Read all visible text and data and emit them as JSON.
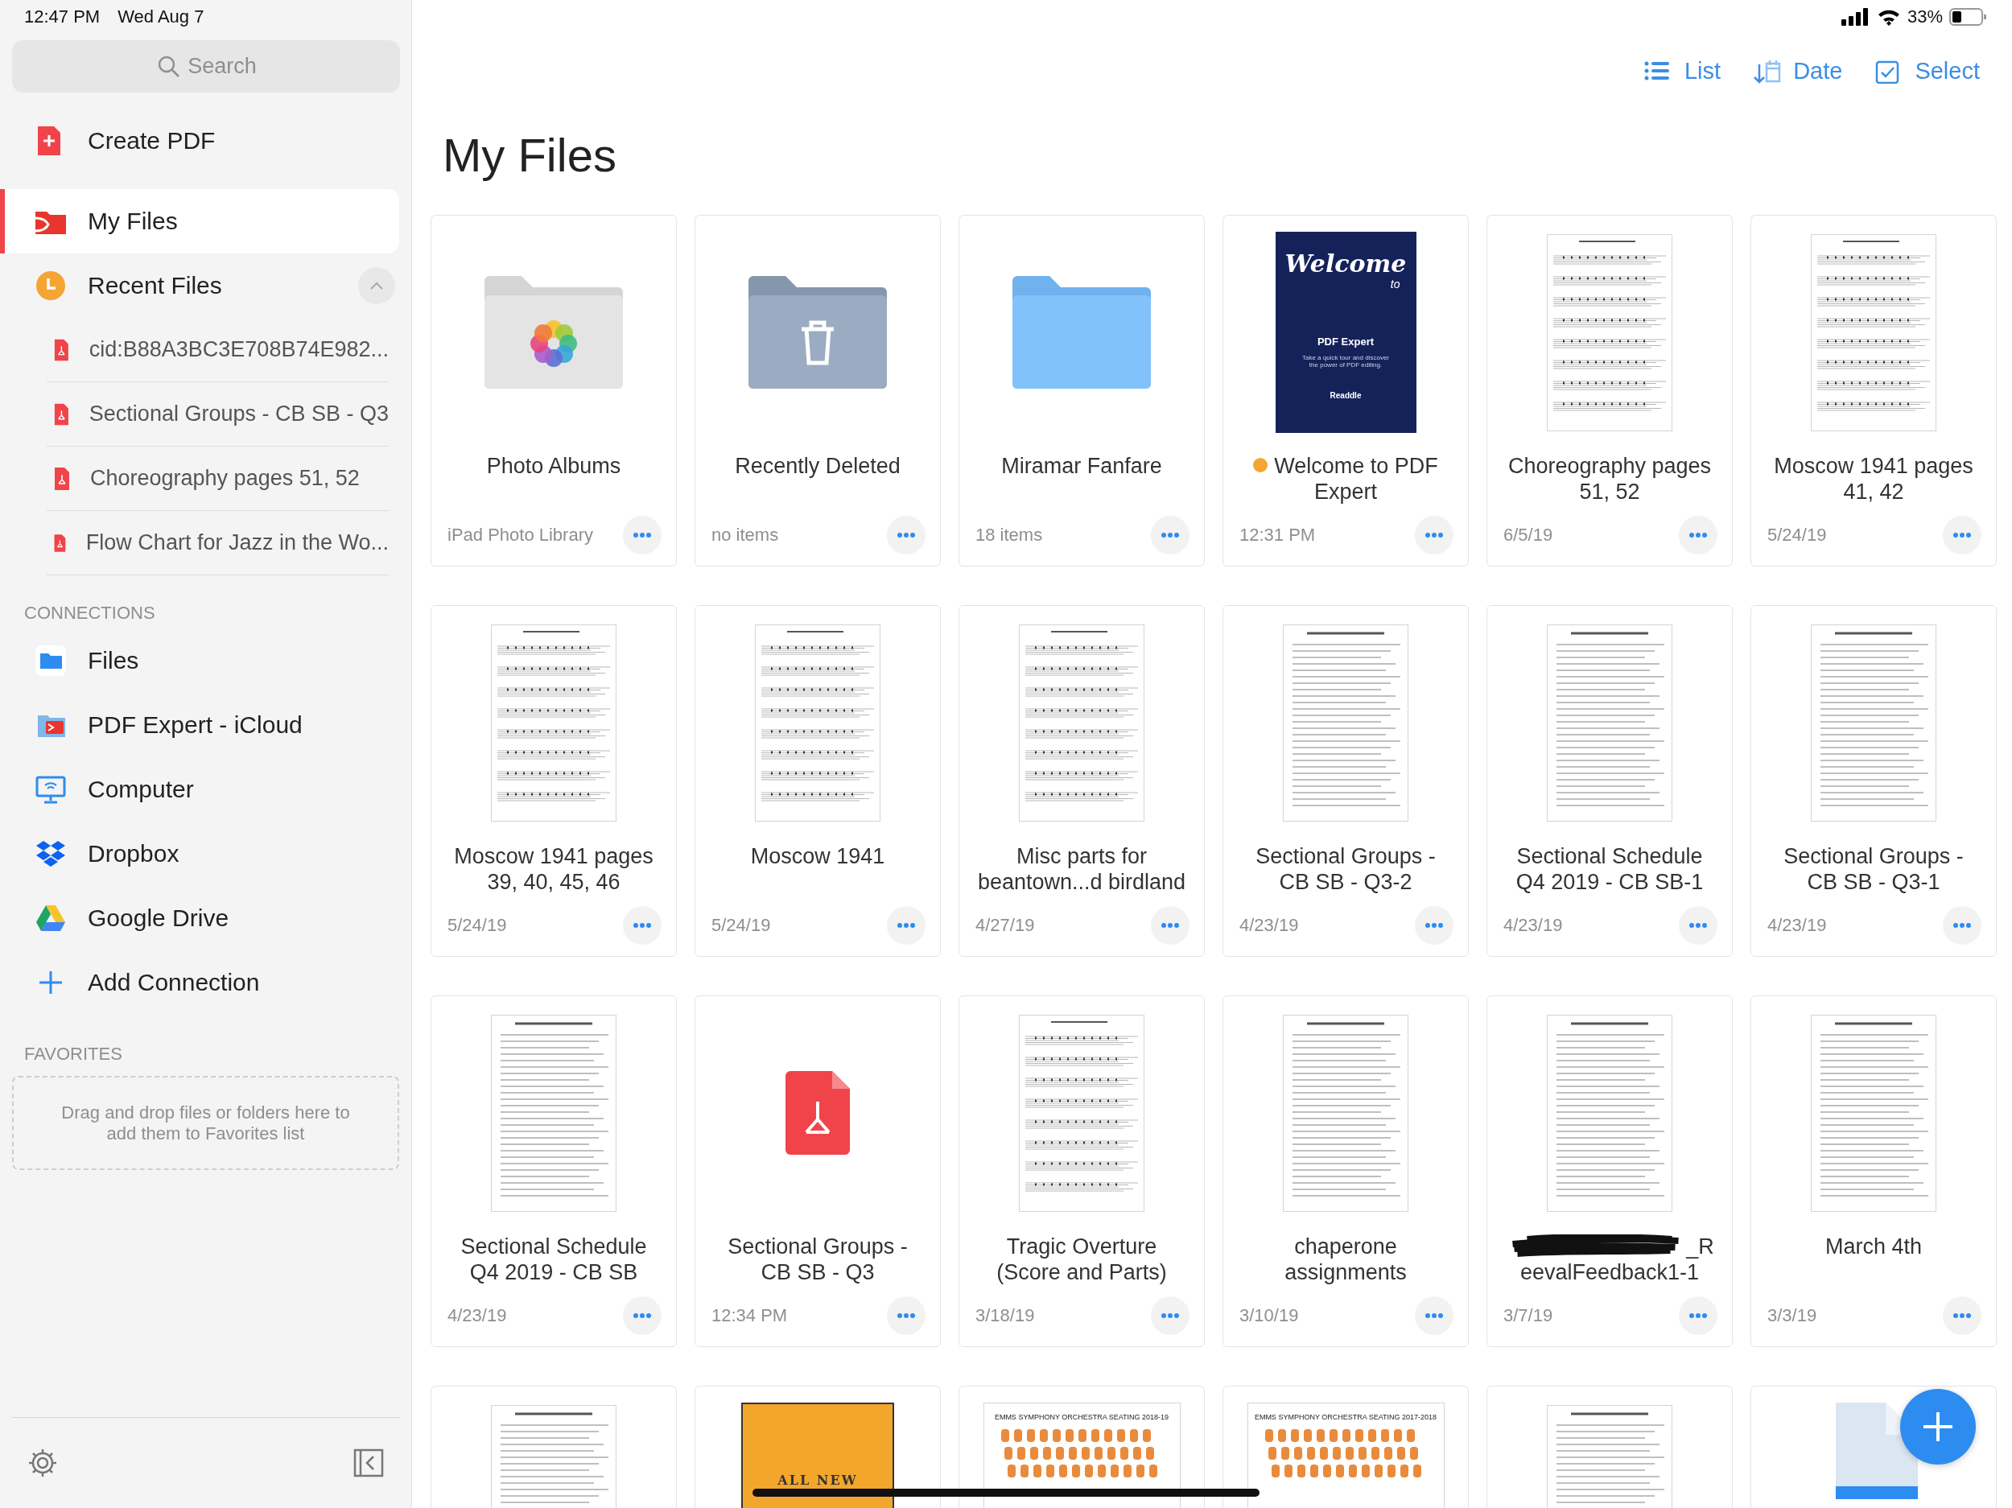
{
  "status_bar": {
    "time": "12:47 PM",
    "date": "Wed Aug 7",
    "battery": "33%"
  },
  "sidebar": {
    "search": {
      "placeholder": "Search"
    },
    "items": [
      {
        "label": "Create PDF",
        "kind": "create",
        "selected": false
      },
      {
        "label": "My Files",
        "kind": "my-files",
        "selected": true
      },
      {
        "label": "Recent Files",
        "kind": "recent",
        "selected": false,
        "expanded": true,
        "children": [
          {
            "label": "cid:B88A3BC3E708B74E982..."
          },
          {
            "label": "Sectional Groups - CB SB - Q3"
          },
          {
            "label": "Choreography pages 51, 52"
          },
          {
            "label": "Flow Chart for Jazz in the Wo..."
          }
        ]
      }
    ],
    "connections": {
      "heading": "CONNECTIONS",
      "items": [
        {
          "label": "Files",
          "kind": "files",
          "selected": false
        },
        {
          "label": "PDF Expert - iCloud",
          "kind": "icloud",
          "selected": false
        },
        {
          "label": "Computer",
          "kind": "computer",
          "selected": false
        },
        {
          "label": "Dropbox",
          "kind": "dropbox",
          "selected": false
        },
        {
          "label": "Google Drive",
          "kind": "drive",
          "selected": false
        },
        {
          "label": "Add Connection",
          "kind": "add",
          "selected": false
        }
      ]
    },
    "favorites": {
      "heading": "FAVORITES",
      "hint": "Drag and drop files or folders here to add them to Favorites list"
    }
  },
  "toolbar": {
    "buttons": [
      {
        "label": "List",
        "kind": "list"
      },
      {
        "label": "Date",
        "kind": "date"
      },
      {
        "label": "Select",
        "kind": "select"
      }
    ]
  },
  "title": "My Files",
  "files": [
    {
      "title": "Photo Albums",
      "subtitle": "iPad Photo Library",
      "thumb": {
        "kind": "photos-folder"
      }
    },
    {
      "title": "Recently Deleted",
      "subtitle": "no items",
      "thumb": {
        "kind": "trash-folder"
      }
    },
    {
      "title": "Miramar Fanfare",
      "subtitle": "18 items",
      "thumb": {
        "kind": "folder"
      }
    },
    {
      "title": "Welcome to PDF Expert",
      "subtitle": "12:31 PM",
      "unread": true,
      "thumb": {
        "kind": "welcome-cover",
        "texts": [
          "Welcome",
          "to",
          "PDF Expert",
          "Take a quick tour and discover the power of PDF editing.",
          "Readdle"
        ]
      }
    },
    {
      "title": "Choreography pages 51, 52",
      "subtitle": "6/5/19",
      "thumb": {
        "kind": "sheet-music"
      }
    },
    {
      "title": "Moscow 1941 pages 41, 42",
      "subtitle": "5/24/19",
      "thumb": {
        "kind": "sheet-music"
      }
    },
    {
      "title": "Moscow 1941 pages 39, 40, 45, 46",
      "subtitle": "5/24/19",
      "thumb": {
        "kind": "sheet-music"
      }
    },
    {
      "title": "Moscow 1941",
      "subtitle": "5/24/19",
      "thumb": {
        "kind": "sheet-music"
      }
    },
    {
      "title": "Misc parts for beantown...d birdland",
      "subtitle": "4/27/19",
      "thumb": {
        "kind": "sheet-music"
      }
    },
    {
      "title": "Sectional Groups - CB SB - Q3-2",
      "subtitle": "4/23/19",
      "thumb": {
        "kind": "document"
      }
    },
    {
      "title": "Sectional Schedule Q4 2019 - CB SB-1",
      "subtitle": "4/23/19",
      "thumb": {
        "kind": "document"
      }
    },
    {
      "title": "Sectional Groups - CB SB - Q3-1",
      "subtitle": "4/23/19",
      "thumb": {
        "kind": "document"
      }
    },
    {
      "title": "Sectional Schedule Q4 2019 - CB SB",
      "subtitle": "4/23/19",
      "thumb": {
        "kind": "document"
      }
    },
    {
      "title": "Sectional Groups - CB SB - Q3",
      "subtitle": "12:34 PM",
      "thumb": {
        "kind": "pdf-icon"
      }
    },
    {
      "title": "Tragic Overture (Score and Parts)",
      "subtitle": "3/18/19",
      "thumb": {
        "kind": "sheet-music"
      }
    },
    {
      "title": "chaperone assignments",
      "subtitle": "3/10/19",
      "thumb": {
        "kind": "document"
      }
    },
    {
      "title": "_ReevalFeedback1-1",
      "subtitle": "3/7/19",
      "redacted": true,
      "thumb": {
        "kind": "document"
      }
    },
    {
      "title": "March 4th",
      "subtitle": "3/3/19",
      "thumb": {
        "kind": "document"
      }
    },
    {
      "thumb": {
        "kind": "document"
      }
    },
    {
      "thumb": {
        "kind": "orange-cover",
        "texts": [
          "ALL NEW"
        ]
      }
    },
    {
      "thumb": {
        "kind": "seating",
        "texts": [
          "EMMS SYMPHONY ORCHESTRA SEATING 2018-19"
        ]
      }
    },
    {
      "thumb": {
        "kind": "seating",
        "texts": [
          "EMMS SYMPHONY ORCHESTRA SEATING 2017-2018"
        ]
      }
    },
    {
      "thumb": {
        "kind": "document"
      }
    },
    {
      "thumb": {
        "kind": "blank-file"
      }
    }
  ]
}
